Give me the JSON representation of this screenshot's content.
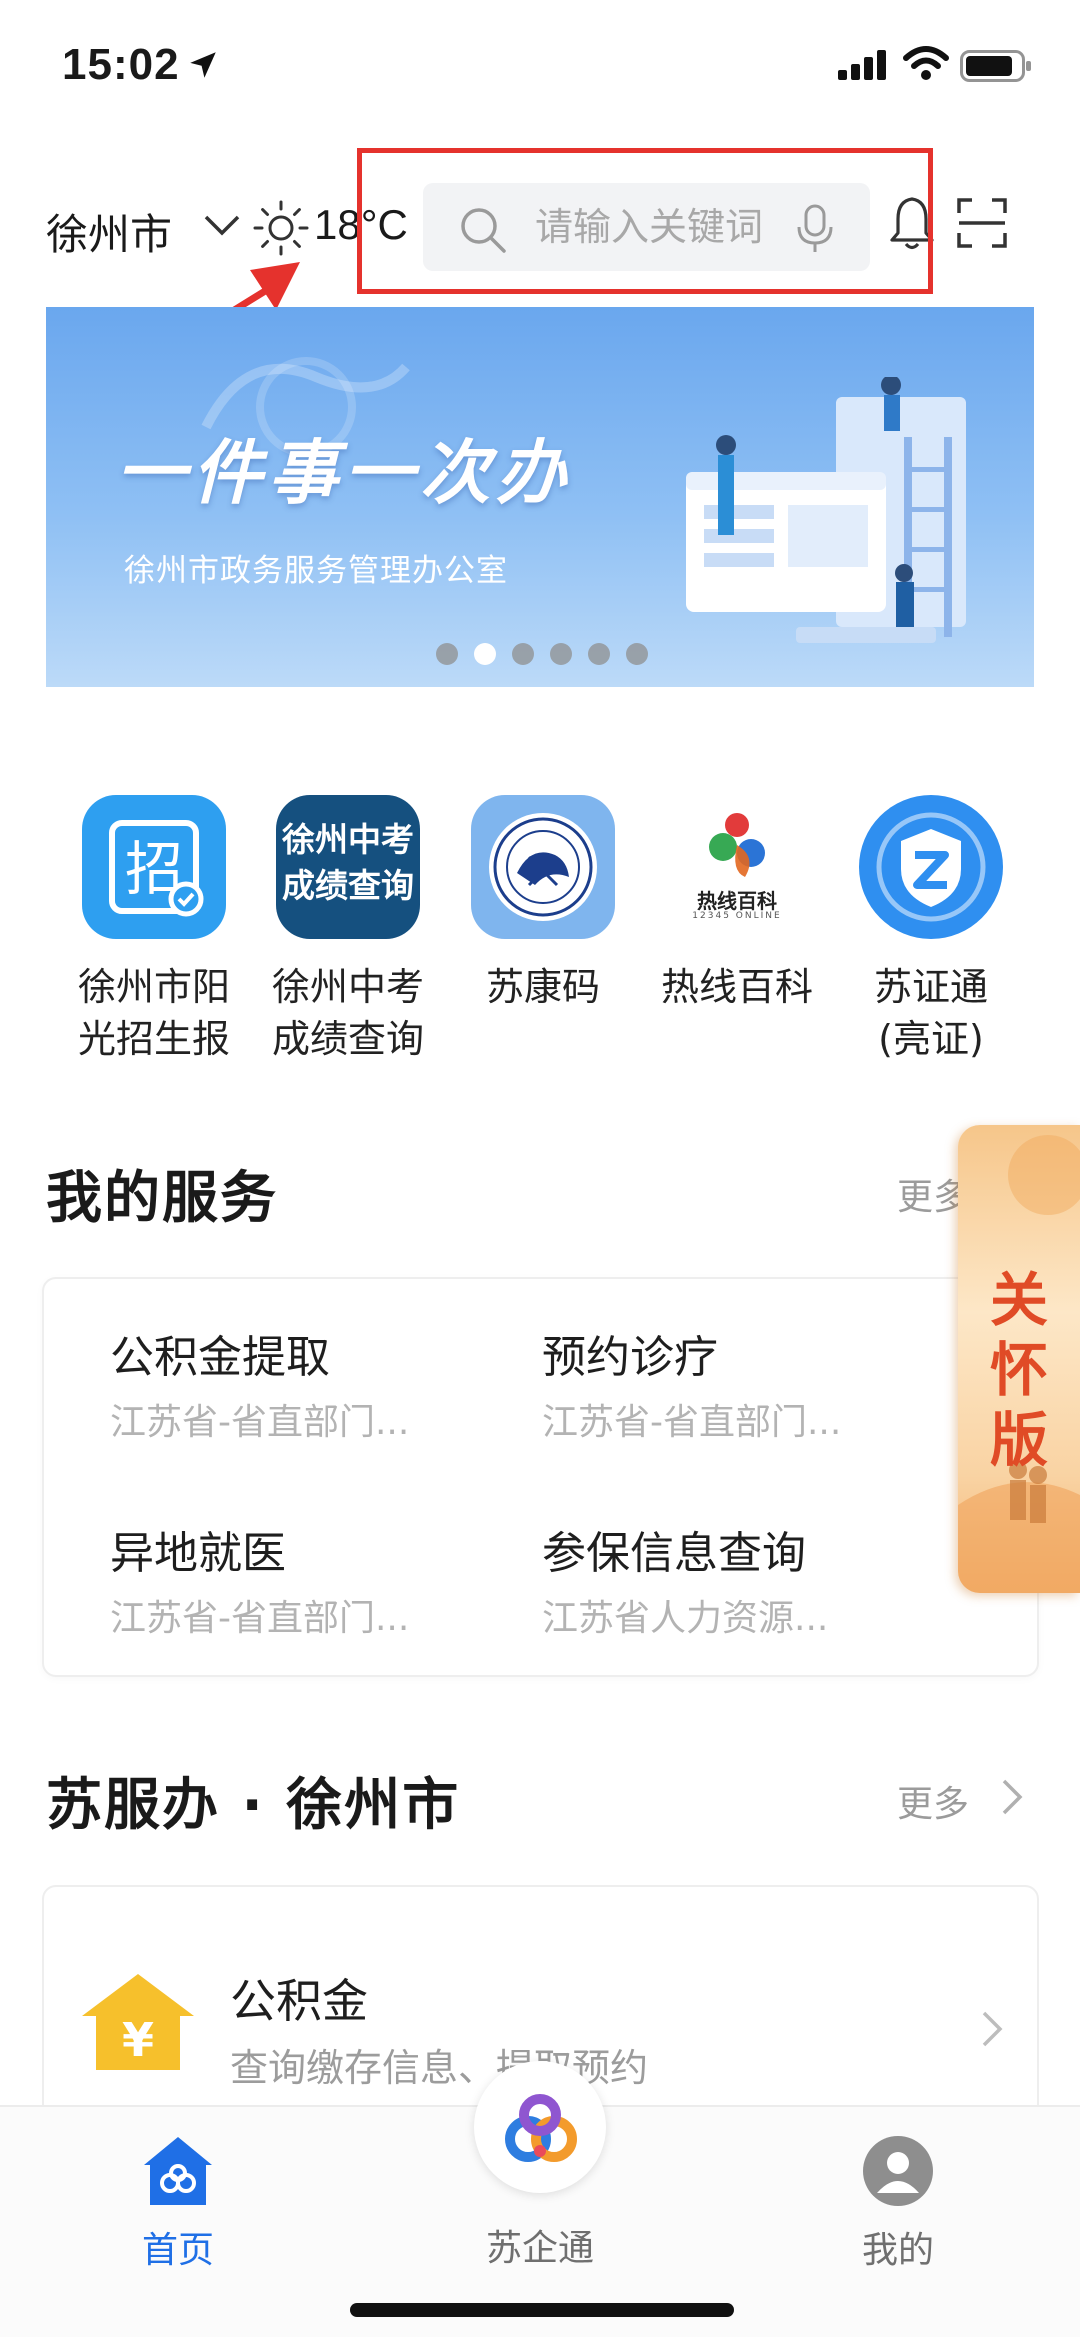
{
  "status_bar": {
    "time": "15:02"
  },
  "header": {
    "city": "徐州市",
    "temperature": "18°C",
    "search_placeholder": "请输入关键词"
  },
  "banner": {
    "title": "一件事一次办",
    "subtitle": "徐州市政务服务管理办公室",
    "dot_count": 6,
    "active_dot": 1
  },
  "quick_apps": [
    {
      "label_line1": "徐州市阳",
      "label_line2": "光招生报",
      "icon": "zhao-icon"
    },
    {
      "label_line1": "徐州中考",
      "label_line2": "成绩查询",
      "icon_text1": "徐州中考",
      "icon_text2": "成绩查询"
    },
    {
      "label_line1": "苏康码",
      "label_line2": "",
      "icon": "sukangma-seal-icon"
    },
    {
      "label_line1": "热线百科",
      "label_line2": "",
      "icon_text": "热线百科",
      "icon_subtext": "12345 ONLINE"
    },
    {
      "label_line1": "苏证通",
      "label_line2": "(亮证)",
      "icon": "suzhengtong-icon"
    }
  ],
  "my_services": {
    "title": "我的服务",
    "more": "更多",
    "items": [
      {
        "name": "公积金提取",
        "desc": "江苏省-省直部门..."
      },
      {
        "name": "预约诊疗",
        "desc": "江苏省-省直部门..."
      },
      {
        "name": "异地就医",
        "desc": "江苏省-省直部门..."
      },
      {
        "name": "参保信息查询",
        "desc": "江苏省人力资源..."
      }
    ]
  },
  "care_mode": {
    "line1": "关",
    "line2": "怀",
    "line3": "版"
  },
  "city_section": {
    "title": "苏服办 · 徐州市",
    "more": "更多",
    "items": [
      {
        "title": "公积金",
        "desc": "查询缴存信息、提取预约"
      }
    ]
  },
  "tabs": [
    {
      "label": "首页",
      "active": true
    },
    {
      "label": "苏企通",
      "active": false
    },
    {
      "label": "我的",
      "active": false
    }
  ],
  "colors": {
    "accent": "#1f6fe6",
    "highlight_box": "#e5322d",
    "care_text": "#e04b26"
  }
}
